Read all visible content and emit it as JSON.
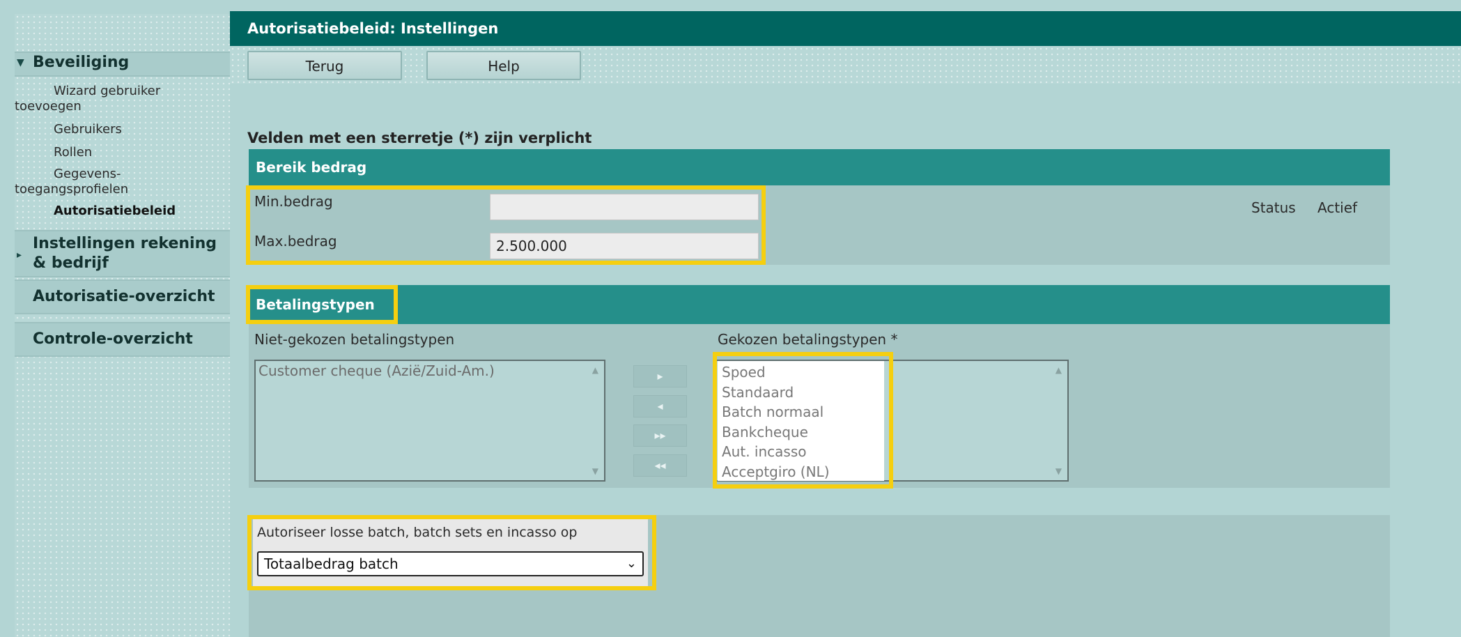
{
  "window_title": "Autorisatiebeleid: Instellingen",
  "toolbar": {
    "back_label": "Terug",
    "help_label": "Help"
  },
  "sidebar": {
    "sections": [
      {
        "label": "Beveiliging",
        "expanded": true
      },
      {
        "label": "Instellingen rekening & bedrijf",
        "label_line1": "Instellingen rekening",
        "label_line2": "& bedrijf",
        "expanded": false
      },
      {
        "label": "Autorisatie-overzicht"
      },
      {
        "label": "Controle-overzicht"
      }
    ],
    "items": [
      {
        "label_line1": "Wizard gebruiker",
        "label_line2": "toevoegen"
      },
      {
        "label": "Gebruikers"
      },
      {
        "label": "Rollen"
      },
      {
        "label_line1": "Gegevens-",
        "label_line2": "toegangsprofielen"
      },
      {
        "label": "Autorisatiebeleid",
        "active": true
      }
    ]
  },
  "required_note": "Velden met een sterretje (*) zijn verplicht",
  "amount_range": {
    "heading": "Bereik bedrag",
    "min_label": "Min.bedrag",
    "min_value": "",
    "max_label": "Max.bedrag",
    "max_value": "2.500.000",
    "status_label": "Status",
    "status_value": "Actief"
  },
  "payment_types": {
    "heading": "Betalingstypen",
    "unselected_label": "Niet-gekozen betalingstypen",
    "unselected": [
      "Customer cheque (Azië/Zuid-Am.)"
    ],
    "selected_label": "Gekozen betalingstypen *",
    "selected": [
      "Spoed",
      "Standaard",
      "Batch normaal",
      "Bankcheque",
      "Aut. incasso",
      "Acceptgiro (NL)"
    ],
    "move_buttons": {
      "add": "▸",
      "remove": "◂",
      "add_all": "▸▸",
      "remove_all": "◂◂"
    }
  },
  "batch_auth": {
    "label": "Autoriseer losse batch, batch sets en incasso op",
    "selected_option": "Totaalbedrag batch"
  },
  "colors": {
    "title_bar": "#006560",
    "panel_header": "#258f8a",
    "highlight": "#f5cf10",
    "background": "#b3d5d4"
  }
}
